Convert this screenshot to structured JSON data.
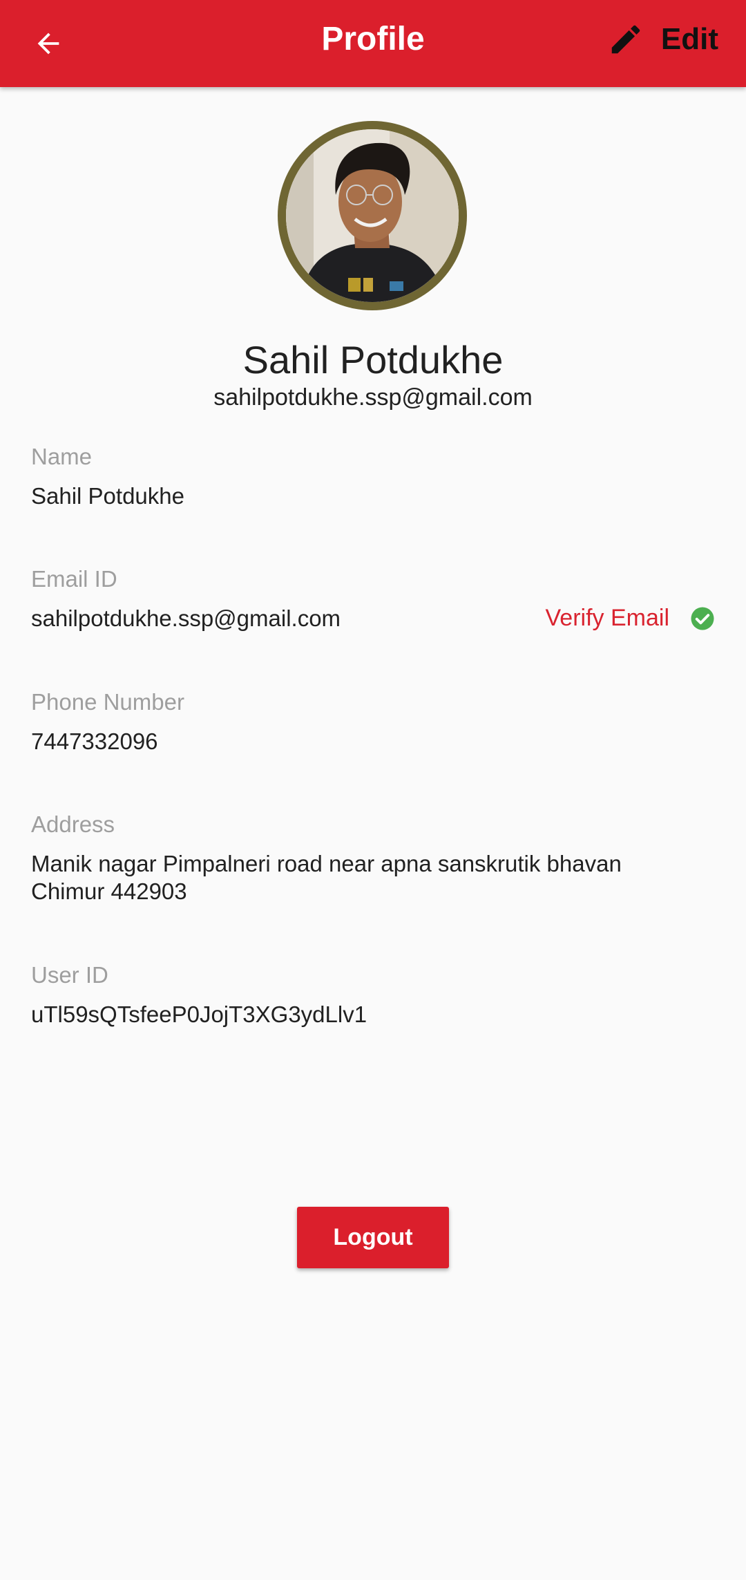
{
  "appbar": {
    "title": "Profile",
    "edit_label": "Edit",
    "color": "#db1f2c"
  },
  "profile": {
    "display_name": "Sahil Potdukhe",
    "display_email": "sahilpotdukhe.ssp@gmail.com"
  },
  "fields": {
    "name": {
      "label": "Name",
      "value": "Sahil Potdukhe"
    },
    "email": {
      "label": "Email ID",
      "value": "sahilpotdukhe.ssp@gmail.com",
      "verify_label": "Verify Email"
    },
    "phone": {
      "label": "Phone Number",
      "value": "7447332096"
    },
    "address": {
      "label": "Address",
      "line1": "Manik nagar Pimpalneri road near apna sanskrutik bhavan",
      "line2": "Chimur 442903"
    },
    "user_id": {
      "label": "User ID",
      "value": "uTl59sQTsfeeP0JojT3XG3ydLlv1"
    }
  },
  "logout_label": "Logout",
  "icons": {
    "back": "arrow-back-icon",
    "edit": "pencil-icon",
    "verified": "check-circle-icon"
  },
  "status_color": "#4caf50"
}
